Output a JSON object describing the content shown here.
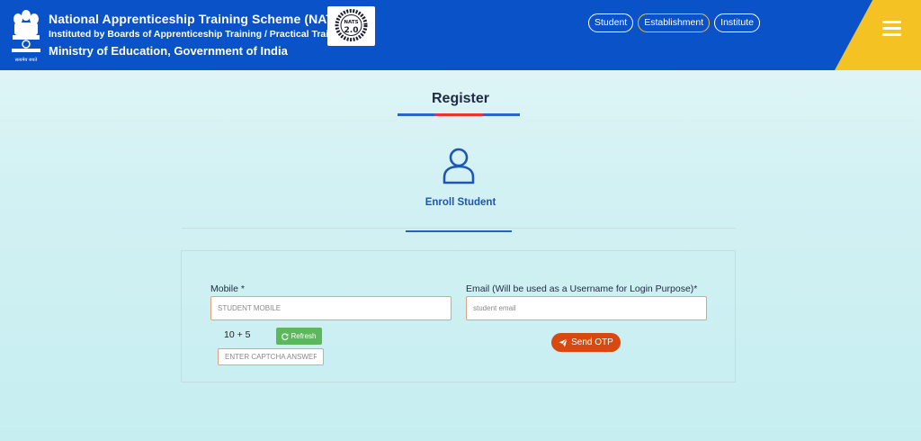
{
  "header": {
    "title": "National Apprenticeship Training Scheme (NATS)",
    "subtitle": "Instituted by Boards of Apprenticeship Training / Practical Training",
    "ministry": "Ministry of Education, Government of India",
    "emblem_caption": "सत्यमेव जयते",
    "logo_text": "NATS",
    "logo_version": "2.0",
    "nav": [
      {
        "label": "Student",
        "active": false
      },
      {
        "label": "Establishment",
        "active": true
      },
      {
        "label": "Institute",
        "active": false
      }
    ],
    "colors": {
      "bar": "#0a52c7",
      "accent": "#f4c223"
    }
  },
  "page": {
    "title": "Register",
    "enroll_label": "Enroll Student"
  },
  "form": {
    "mobile_label": "Mobile *",
    "mobile_placeholder": "STUDENT MOBILE",
    "email_label": "Email (Will be used as a Username for Login Purpose)*",
    "email_placeholder": "student email",
    "captcha_question": "10 + 5",
    "refresh_label": "Refresh",
    "captcha_placeholder": "ENTER CAPTCHA ANSWER",
    "send_otp_label": "Send OTP"
  }
}
